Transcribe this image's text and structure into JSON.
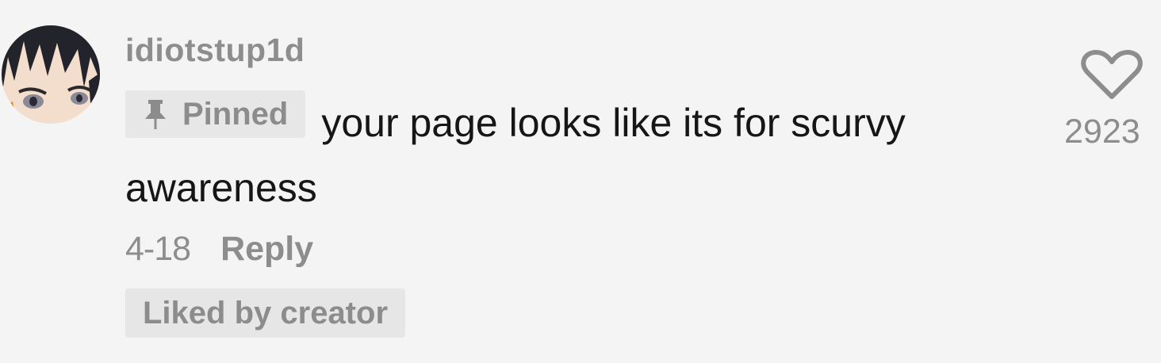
{
  "comment": {
    "username": "idiotstup1d",
    "pinned_label": "Pinned",
    "text": "your page looks like its for scurvy awareness",
    "date": "4-18",
    "reply_label": "Reply",
    "liked_by_creator_label": "Liked by creator",
    "like_count": "2923",
    "avatar_icon": "anime-avatar-icon",
    "like_icon": "heart-outline-icon"
  },
  "colors": {
    "background": "#f4f4f4",
    "secondary_text": "#8d8d8d",
    "primary_text": "#161616",
    "badge_bg": "#e7e7e7"
  }
}
